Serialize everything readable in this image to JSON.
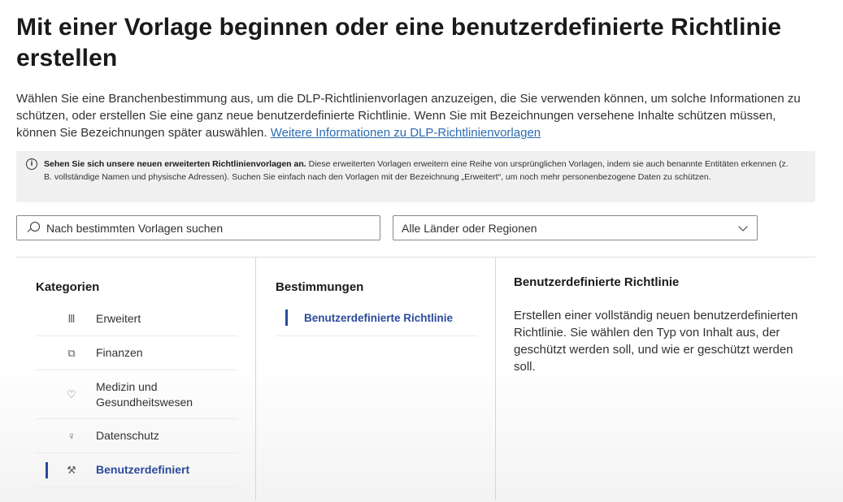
{
  "header": {
    "title": "Mit einer Vorlage beginnen oder eine benutzerdefinierte Richtlinie erstellen"
  },
  "intro": {
    "text": "Wählen Sie eine Branchenbestimmung aus, um die DLP-Richtlinienvorlagen anzuzeigen, die Sie verwenden können, um solche Informationen zu schützen, oder erstellen Sie eine ganz neue benutzerdefinierte Richtlinie. Wenn Sie mit Bezeichnungen versehene Inhalte schützen müssen, können Sie Bezeichnungen später auswählen.",
    "link": "Weitere Informationen zu DLP-Richtlinienvorlagen"
  },
  "banner": {
    "icon": "info-icon",
    "bold": "Sehen Sie sich unsere neuen erweiterten Richtlinienvorlagen an.",
    "text": "Diese erweiterten Vorlagen erweitern eine Reihe von ursprünglichen Vorlagen, indem sie auch benannte Entitäten erkennen (z. B. vollständige Namen und physische Adressen). Suchen Sie einfach nach den Vorlagen mit der Bezeichnung „Erweitert“, um noch mehr personenbezogene Daten zu schützen."
  },
  "filters": {
    "search_placeholder": "Nach bestimmten Vorlagen suchen",
    "region_selected": "Alle Länder oder Regionen"
  },
  "categories": {
    "title": "Kategorien",
    "items": [
      {
        "label": "Erweitert",
        "icon": "library-icon"
      },
      {
        "label": "Finanzen",
        "icon": "cards-icon"
      },
      {
        "label": "Medizin und Gesundheitswesen",
        "icon": "heart-pulse-icon"
      },
      {
        "label": "Datenschutz",
        "icon": "person-shield-icon"
      },
      {
        "label": "Benutzerdefiniert",
        "icon": "wrench-icon",
        "active": true
      }
    ]
  },
  "regulations": {
    "title": "Bestimmungen",
    "items": [
      {
        "label": "Benutzerdefinierte Richtlinie",
        "active": true
      }
    ]
  },
  "details": {
    "title": "Benutzerdefinierte Richtlinie",
    "description": "Erstellen einer vollständig neuen benutzerdefinierten Richtlinie. Sie wählen den Typ von Inhalt aus, der geschützt werden soll, und wie er geschützt werden soll."
  },
  "colors": {
    "accent": "#2b4a9a",
    "link": "#2b6cb0",
    "banner_bg": "#f0f0f0"
  }
}
